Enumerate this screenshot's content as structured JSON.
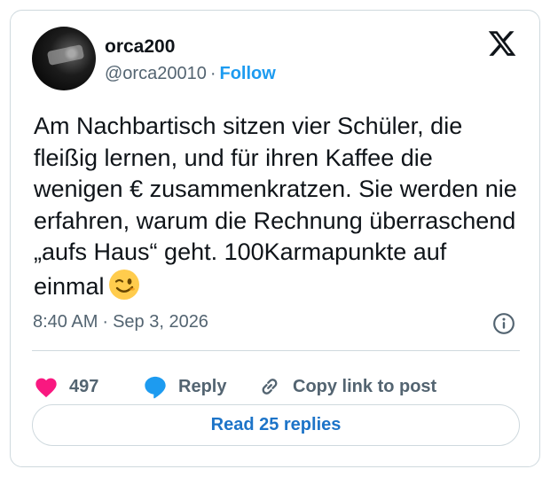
{
  "author": {
    "display_name": "orca200",
    "handle": "@orca20010",
    "separator": "·",
    "follow_label": "Follow"
  },
  "tweet": {
    "text": "Am Nachbartisch sitzen vier Schüler, die fleißig lernen, und für ihren Kaffee die wenigen € zusammenkratzen. Sie werden nie erfahren, warum die Rechnung überraschend „aufs Haus“ geht. 100Karmapunkte auf einmal",
    "emoji": "winking-face",
    "time": "8:40 AM",
    "separator": "·",
    "date": "Sep 3, 2026"
  },
  "actions": {
    "like_count": "497",
    "reply_label": "Reply",
    "copy_label": "Copy link to post"
  },
  "footer": {
    "read_replies_label": "Read 25 replies"
  },
  "colors": {
    "like": "#f91880",
    "accent": "#1d9bf0",
    "reply_icon": "#1d9bf0",
    "muted_text": "#536471",
    "border": "#cfd9de"
  },
  "icons": [
    "x-logo-icon",
    "info-icon",
    "heart-icon",
    "speech-bubble-icon",
    "link-icon",
    "winking-face-emoji"
  ]
}
